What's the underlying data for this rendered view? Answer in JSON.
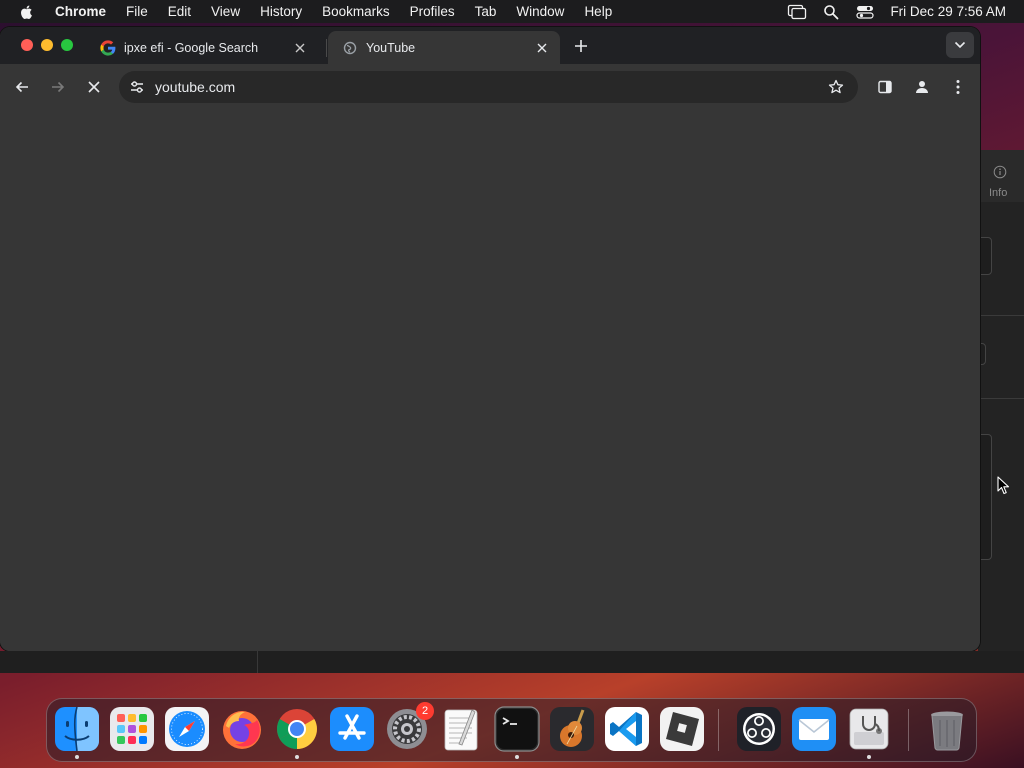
{
  "menubar": {
    "app_name": "Chrome",
    "items": [
      "File",
      "Edit",
      "View",
      "History",
      "Bookmarks",
      "Profiles",
      "Tab",
      "Window",
      "Help"
    ],
    "clock": "Fri Dec 29  7:56 AM"
  },
  "background_app": {
    "info_label": "Info"
  },
  "browser": {
    "tabs": [
      {
        "title": "ipxe efi - Google Search",
        "favicon": "google-icon",
        "active": false
      },
      {
        "title": "YouTube",
        "favicon": "loading-globe-icon",
        "active": true
      }
    ],
    "omnibox": {
      "url": "youtube.com"
    },
    "loading": true
  },
  "dock": {
    "apps": [
      {
        "name": "Finder",
        "icon": "finder-icon",
        "running": true
      },
      {
        "name": "Launchpad",
        "icon": "launchpad-icon",
        "running": false
      },
      {
        "name": "Safari",
        "icon": "safari-icon",
        "running": false
      },
      {
        "name": "Firefox",
        "icon": "firefox-icon",
        "running": false
      },
      {
        "name": "Google Chrome",
        "icon": "chrome-icon",
        "running": true
      },
      {
        "name": "App Store",
        "icon": "app-store-icon",
        "running": false
      },
      {
        "name": "System Settings",
        "icon": "system-settings-icon",
        "running": false,
        "badge": "2"
      },
      {
        "name": "TextEdit",
        "icon": "textedit-icon",
        "running": false
      },
      {
        "name": "Terminal",
        "icon": "terminal-icon",
        "running": true
      },
      {
        "name": "GarageBand",
        "icon": "garageband-icon",
        "running": false
      },
      {
        "name": "Visual Studio Code",
        "icon": "vscode-icon",
        "running": false
      },
      {
        "name": "Roblox",
        "icon": "roblox-icon",
        "running": false
      },
      {
        "name": "OBS",
        "icon": "obs-icon",
        "running": false
      },
      {
        "name": "Mail",
        "icon": "mail-icon",
        "running": false
      },
      {
        "name": "Disk Utility",
        "icon": "disk-utility-icon",
        "running": true
      },
      {
        "name": "Trash",
        "icon": "trash-icon",
        "running": false
      }
    ]
  }
}
